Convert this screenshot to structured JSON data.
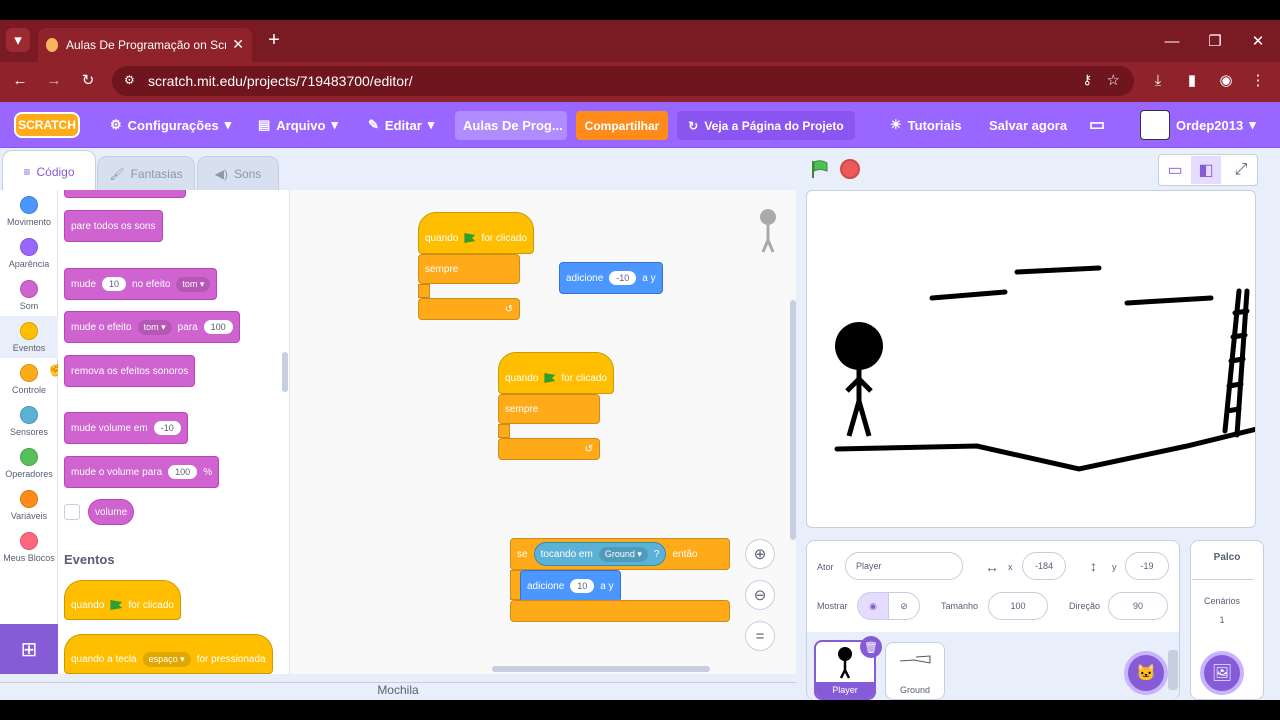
{
  "browser": {
    "tab_title": "Aulas De Programação on Scratch",
    "url": "scratch.mit.edu/projects/719483700/editor/"
  },
  "menu": {
    "logo": "SCRATCH",
    "settings": "Configurações",
    "file": "Arquivo",
    "edit": "Editar",
    "project_title": "Aulas De Prog...",
    "share": "Compartilhar",
    "see_project": "Veja a Página do Projeto",
    "tutorials": "Tutoriais",
    "save_now": "Salvar agora",
    "username": "Ordep2013"
  },
  "tabs": {
    "code": "Código",
    "costumes": "Fantasias",
    "sounds": "Sons"
  },
  "categories": [
    {
      "label": "Movimento",
      "color": "#4c97ff"
    },
    {
      "label": "Aparência",
      "color": "#9966ff"
    },
    {
      "label": "Som",
      "color": "#cf63cf"
    },
    {
      "label": "Eventos",
      "color": "#ffbf00"
    },
    {
      "label": "Controle",
      "color": "#ffab19"
    },
    {
      "label": "Sensores",
      "color": "#5cb1d6"
    },
    {
      "label": "Operadores",
      "color": "#59c059"
    },
    {
      "label": "Variáveis",
      "color": "#ff8c1a"
    },
    {
      "label": "Meus Blocos",
      "color": "#ff6680"
    }
  ],
  "palette": {
    "stop_all_sounds": "pare todos os sons",
    "change_effect": "mude",
    "change_effect_value": "10",
    "change_effect_mid": "no efeito",
    "effect_name": "tom",
    "set_effect": "mude o efeito",
    "set_effect_to": "para",
    "set_effect_value": "100",
    "clear_effects": "remova os efeitos sonoros",
    "change_volume": "mude volume em",
    "change_volume_value": "-10",
    "set_volume": "mude o volume para",
    "set_volume_value": "100",
    "percent": "%",
    "volume": "volume",
    "events_heading": "Eventos",
    "when_flag_1": "quando",
    "when_flag_2": "for clicado",
    "when_key_1": "quando a tecla",
    "key_name": "espaço",
    "when_key_2": "for pressionada"
  },
  "workspace": {
    "when": "quando",
    "clicked": "for clicado",
    "forever": "sempre",
    "change_y": "adicione",
    "change_y_value_1": "-10",
    "change_y_value_2": "10",
    "a_y": "a y",
    "if": "se",
    "touching": "tocando em",
    "ground": "Ground",
    "question": "?",
    "then": "então",
    "zoom_reset": "="
  },
  "sprite_info": {
    "label_sprite": "Ator",
    "sprite_name": "Player",
    "x_label": "x",
    "x_value": "-184",
    "y_label": "y",
    "y_value": "-19",
    "show_label": "Mostrar",
    "size_label": "Tamanho",
    "size_value": "100",
    "direction_label": "Direção",
    "direction_value": "90"
  },
  "sprites": [
    {
      "name": "Player",
      "selected": true
    },
    {
      "name": "Ground",
      "selected": false
    }
  ],
  "stage_panel": {
    "title": "Palco",
    "backdrops_label": "Cenários",
    "backdrops_count": "1"
  },
  "backpack": "Mochila"
}
